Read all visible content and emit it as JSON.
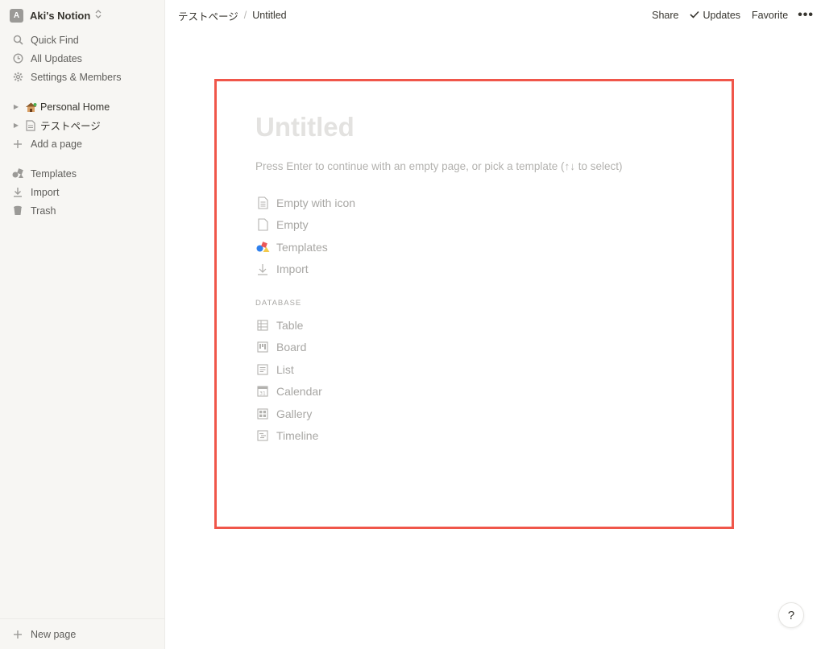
{
  "workspace": {
    "avatar_letter": "A",
    "name": "Aki's Notion"
  },
  "sidebar": {
    "top_items": [
      {
        "label": "Quick Find",
        "icon": "search-icon"
      },
      {
        "label": "All Updates",
        "icon": "clock-icon"
      },
      {
        "label": "Settings & Members",
        "icon": "gear-icon"
      }
    ],
    "pages": [
      {
        "label": "Personal Home",
        "icon": "house-emoji-icon"
      },
      {
        "label": "テストページ",
        "icon": "page-icon"
      }
    ],
    "add_page": "Add a page",
    "tools": [
      {
        "label": "Templates",
        "icon": "templates-icon"
      },
      {
        "label": "Import",
        "icon": "import-icon"
      },
      {
        "label": "Trash",
        "icon": "trash-icon"
      }
    ],
    "new_page": "New page"
  },
  "topbar": {
    "breadcrumb": [
      "テストページ",
      "Untitled"
    ],
    "separator": "/",
    "share": "Share",
    "updates": "Updates",
    "favorite": "Favorite",
    "more": "•••"
  },
  "page": {
    "title_placeholder": "Untitled",
    "hint": "Press Enter to continue with an empty page, or pick a template (↑↓ to select)",
    "options": [
      {
        "label": "Empty with icon",
        "icon": "page-with-lines-icon"
      },
      {
        "label": "Empty",
        "icon": "blank-page-icon"
      },
      {
        "label": "Templates",
        "icon": "templates-icon"
      },
      {
        "label": "Import",
        "icon": "import-icon"
      }
    ],
    "database_label": "DATABASE",
    "database_options": [
      {
        "label": "Table",
        "icon": "table-icon"
      },
      {
        "label": "Board",
        "icon": "board-icon"
      },
      {
        "label": "List",
        "icon": "list-icon"
      },
      {
        "label": "Calendar",
        "icon": "calendar-icon"
      },
      {
        "label": "Gallery",
        "icon": "gallery-icon"
      },
      {
        "label": "Timeline",
        "icon": "timeline-icon"
      }
    ]
  },
  "help": "?",
  "colors": {
    "highlight_border": "#f0564a",
    "sidebar_bg": "#f7f6f3"
  }
}
